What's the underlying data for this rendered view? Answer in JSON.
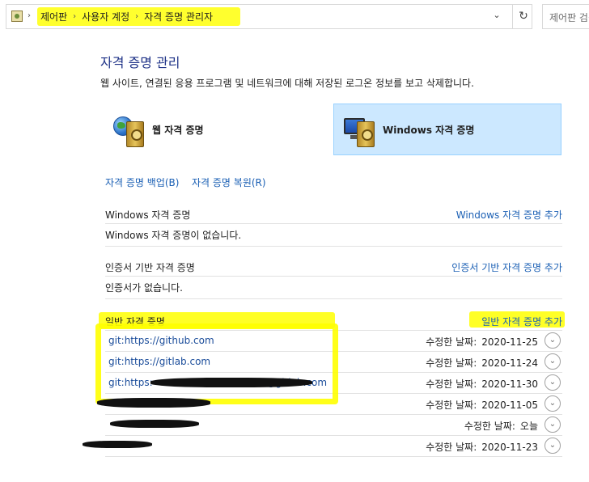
{
  "address_bar": {
    "crumbs": [
      "제어판",
      "사용자 계정",
      "자격 증명 관리자"
    ],
    "dropdown_icon": "chevron-down-icon",
    "refresh_icon": "refresh-icon"
  },
  "search": {
    "placeholder": "제어판 검색"
  },
  "header": {
    "title": "자격 증명 관리",
    "description": "웹 사이트, 연결된 응용 프로그램 및 네트워크에 대해 저장된 로그온 정보를 보고 삭제합니다."
  },
  "tiles": {
    "web": {
      "label": "웹 자격 증명",
      "icon": "web-credentials-icon"
    },
    "windows": {
      "label": "Windows 자격 증명",
      "icon": "windows-credentials-icon",
      "selected": true
    }
  },
  "links": {
    "backup": "자격 증명 백업(B)",
    "restore": "자격 증명 복원(R)"
  },
  "sections": {
    "windows": {
      "title": "Windows 자격 증명",
      "add": "Windows 자격 증명 추가",
      "empty": "Windows 자격 증명이 없습니다."
    },
    "certificate": {
      "title": "인증서 기반 자격 증명",
      "add": "인증서 기반 자격 증명 추가",
      "empty": "인증서가 없습니다."
    },
    "generic": {
      "title": "일반 자격 증명",
      "add": "일반 자격 증명 추가",
      "modified_label": "수정한 날짜:",
      "items": [
        {
          "name": "git:https://github.com",
          "date": "2020-11-25"
        },
        {
          "name": "git:https://gitlab.com",
          "date": "2020-11-24"
        },
        {
          "name": "git:https:",
          "name_suffix": "@gitlab.com",
          "date": "2020-11-30"
        },
        {
          "name": "",
          "date": "2020-11-05"
        },
        {
          "name": "",
          "date": "오늘"
        },
        {
          "name": "",
          "date": "2020-11-23"
        }
      ]
    }
  },
  "colors": {
    "link": "#1a5fb4",
    "selected_tile": "#cce8ff",
    "highlight": "#ffff00"
  }
}
